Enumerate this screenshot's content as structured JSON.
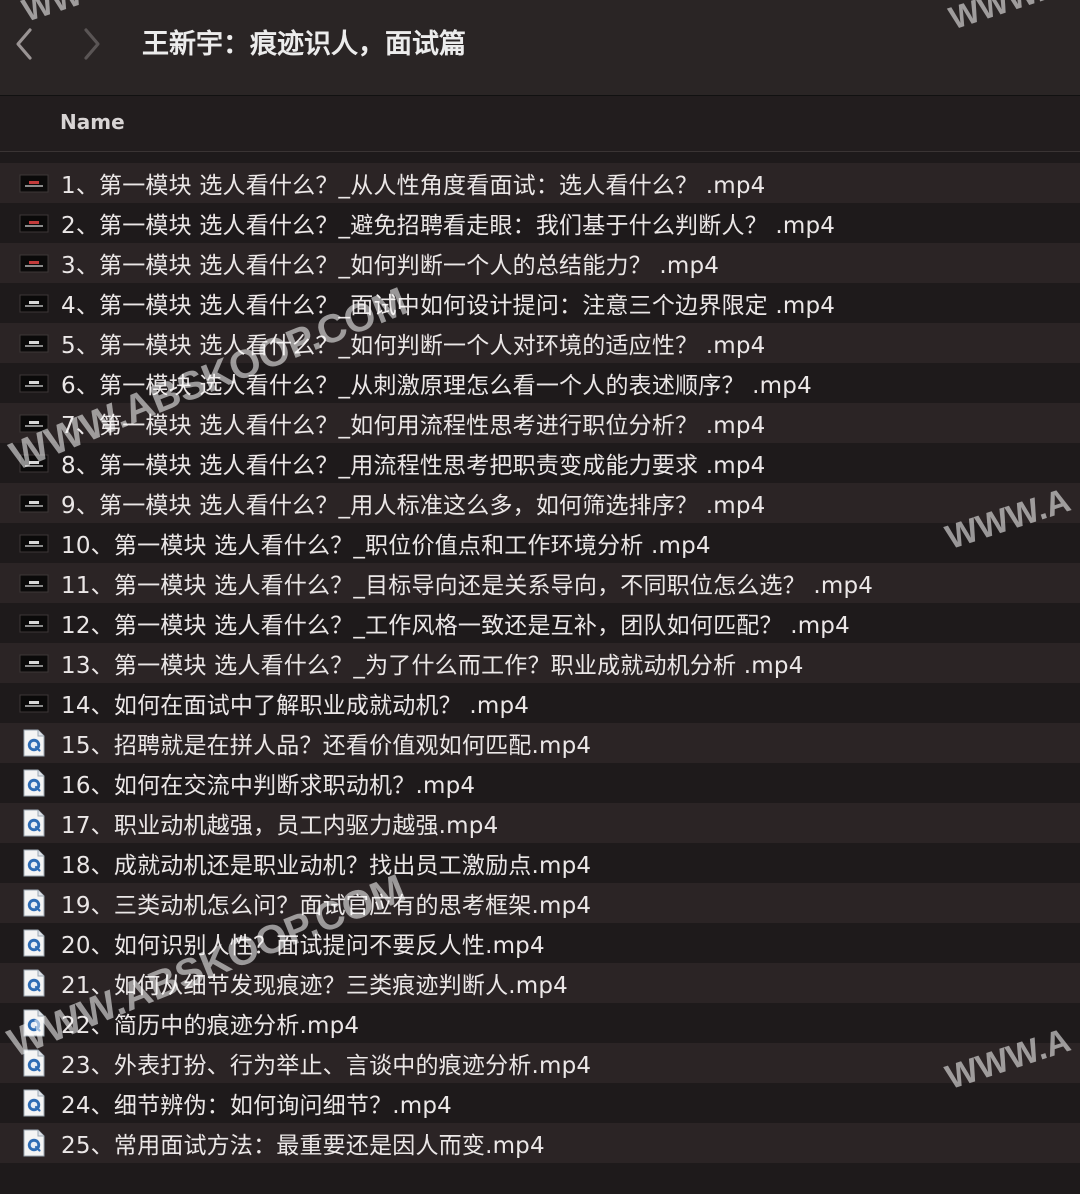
{
  "window": {
    "title": "王新宇：痕迹识人，面试篇"
  },
  "nav": {
    "back_icon": "chevron-left-icon",
    "forward_icon": "chevron-right-icon"
  },
  "columns": {
    "name": "Name"
  },
  "files": [
    {
      "name": "1、第一模块  选人看什么？_从人性角度看面试：选人看什么？ .mp4",
      "icon": "video-thumbnail-red"
    },
    {
      "name": "2、第一模块  选人看什么？_避免招聘看走眼：我们基于什么判断人？ .mp4",
      "icon": "video-thumbnail-red"
    },
    {
      "name": "3、第一模块  选人看什么？_如何判断一个人的总结能力？ .mp4",
      "icon": "video-thumbnail-red"
    },
    {
      "name": "4、第一模块  选人看什么？_面试中如何设计提问：注意三个边界限定 .mp4",
      "icon": "video-thumbnail"
    },
    {
      "name": "5、第一模块  选人看什么？_如何判断一个人对环境的适应性？ .mp4",
      "icon": "video-thumbnail"
    },
    {
      "name": "6、第一模块  选人看什么？_从刺激原理怎么看一个人的表述顺序？ .mp4",
      "icon": "video-thumbnail"
    },
    {
      "name": "7、第一模块  选人看什么？_如何用流程性思考进行职位分析？ .mp4",
      "icon": "video-thumbnail"
    },
    {
      "name": "8、第一模块  选人看什么？_用流程性思考把职责变成能力要求 .mp4",
      "icon": "video-thumbnail"
    },
    {
      "name": "9、第一模块  选人看什么？_用人标准这么多，如何筛选排序？ .mp4",
      "icon": "video-thumbnail"
    },
    {
      "name": "10、第一模块  选人看什么？_职位价值点和工作环境分析 .mp4",
      "icon": "video-thumbnail"
    },
    {
      "name": "11、第一模块  选人看什么？_目标导向还是关系导向，不同职位怎么选？ .mp4",
      "icon": "video-thumbnail"
    },
    {
      "name": "12、第一模块  选人看什么？_工作风格一致还是互补，团队如何匹配？ .mp4",
      "icon": "video-thumbnail"
    },
    {
      "name": "13、第一模块  选人看什么？_为了什么而工作？职业成就动机分析 .mp4",
      "icon": "video-thumbnail"
    },
    {
      "name": "14、如何在面试中了解职业成就动机？ .mp4",
      "icon": "video-thumbnail"
    },
    {
      "name": "15、招聘就是在拼人品？还看价值观如何匹配.mp4",
      "icon": "quicktime-file-icon"
    },
    {
      "name": "16、如何在交流中判断求职动机？.mp4",
      "icon": "quicktime-file-icon"
    },
    {
      "name": "17、职业动机越强，员工内驱力越强.mp4",
      "icon": "quicktime-file-icon"
    },
    {
      "name": "18、成就动机还是职业动机？找出员工激励点.mp4",
      "icon": "quicktime-file-icon"
    },
    {
      "name": "19、三类动机怎么问？面试官应有的思考框架.mp4",
      "icon": "quicktime-file-icon"
    },
    {
      "name": "20、如何识别人性？面试提问不要反人性.mp4",
      "icon": "quicktime-file-icon"
    },
    {
      "name": "21、如何从细节发现痕迹？三类痕迹判断人.mp4",
      "icon": "quicktime-file-icon"
    },
    {
      "name": "22、简历中的痕迹分析.mp4",
      "icon": "quicktime-file-icon"
    },
    {
      "name": "23、外表打扮、行为举止、言谈中的痕迹分析.mp4",
      "icon": "quicktime-file-icon"
    },
    {
      "name": "24、细节辨伪：如何询问细节？.mp4",
      "icon": "quicktime-file-icon"
    },
    {
      "name": "25、常用面试方法：最重要还是因人而变.mp4",
      "icon": "quicktime-file-icon"
    }
  ],
  "watermarks": {
    "diagonal_1": "WWW.ABSKOOP.COM",
    "diagonal_2": "WWW.ABSKOOP.COM",
    "edge_top_left": "WW",
    "edge_top_right": "WWW.",
    "edge_mid_right": "WWW.A",
    "edge_bottom_right": "WWW.A"
  },
  "colors": {
    "window_bg": "#1e1a1b",
    "row_alt_bg": "#2b2425",
    "toolbar_bg": "#2a2525",
    "text": "#ebe7e7"
  }
}
